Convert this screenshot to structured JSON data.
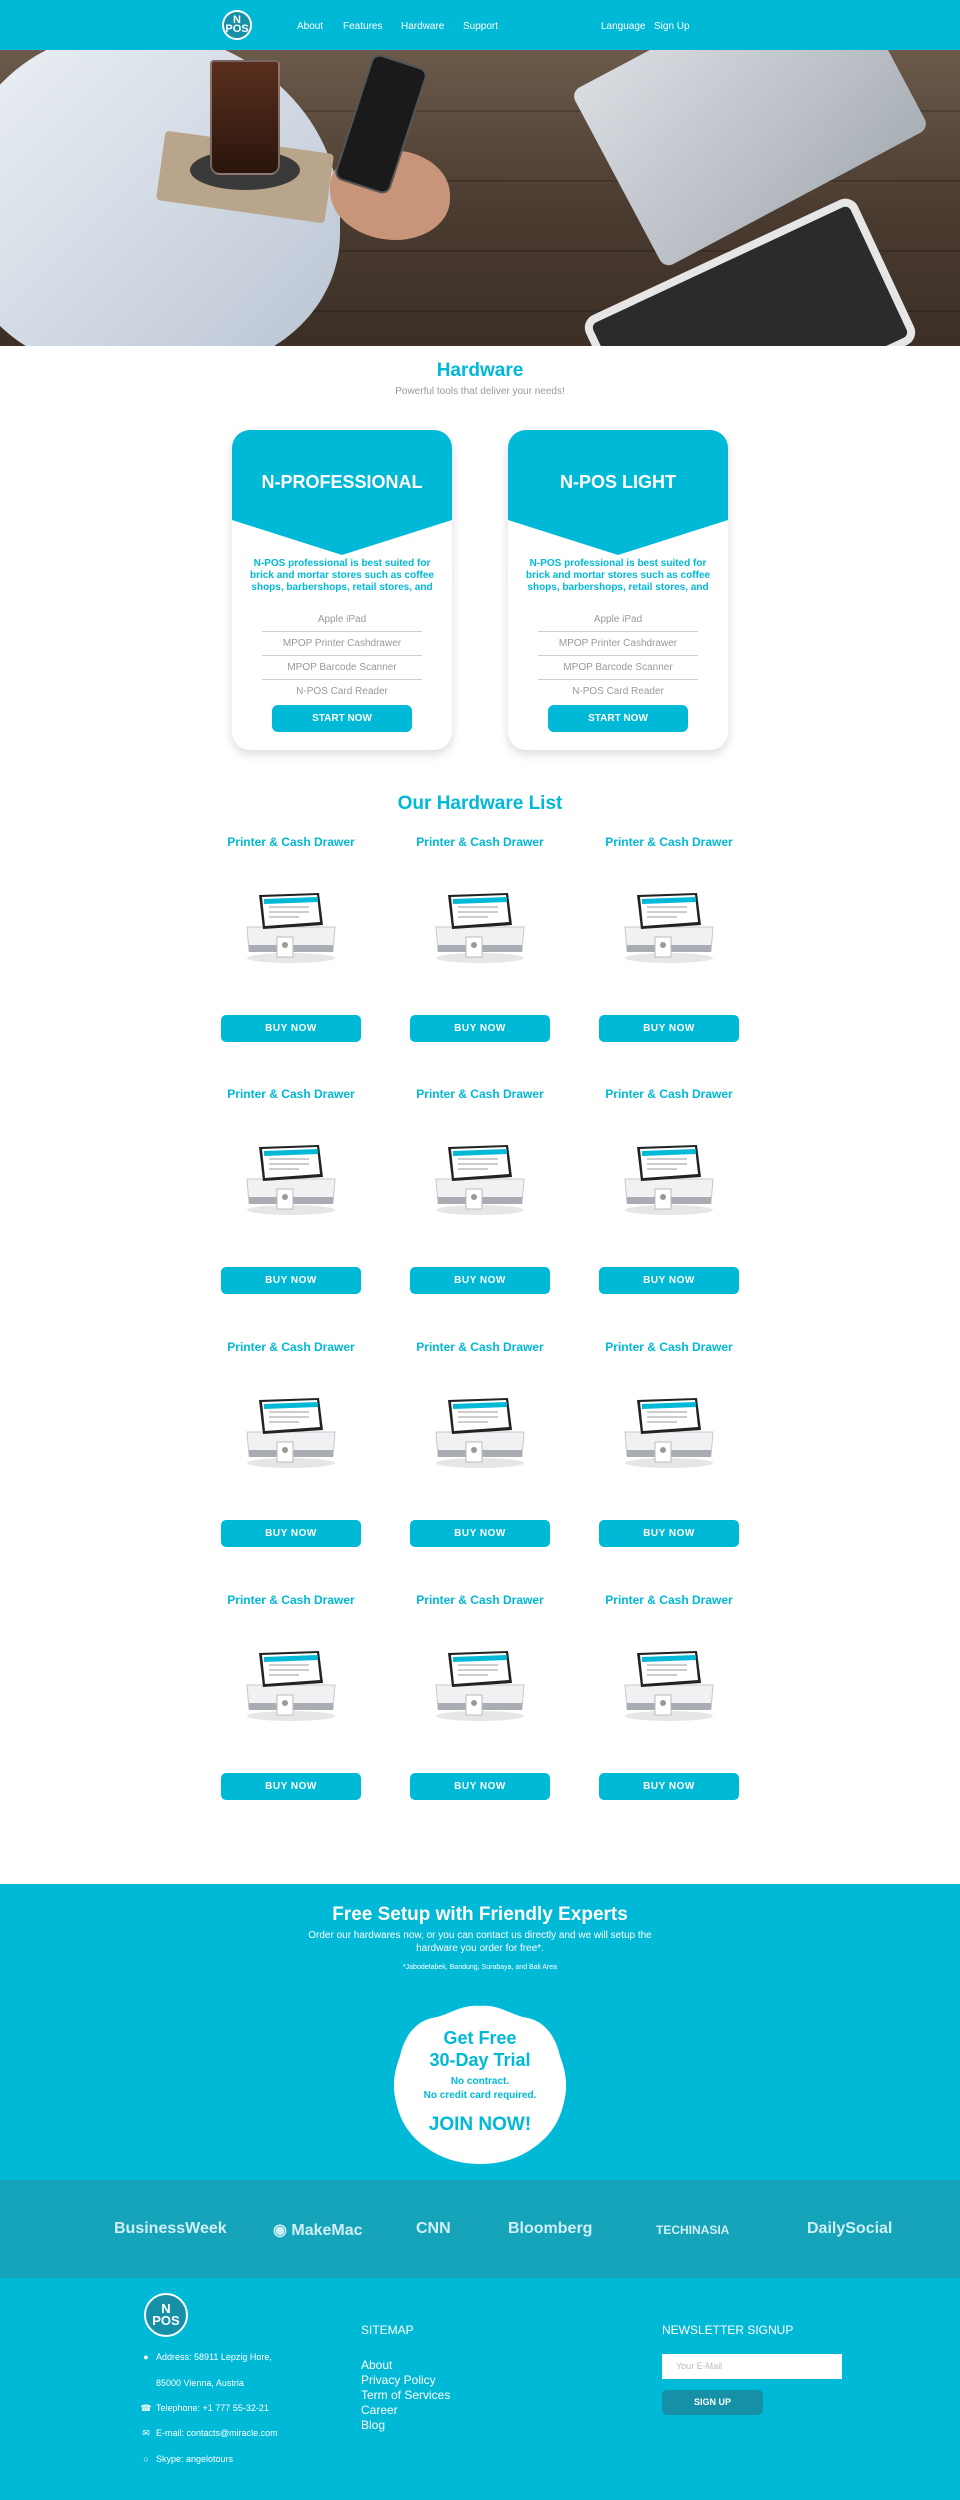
{
  "nav": {
    "logo_text": "N POS",
    "links": [
      "About",
      "Features",
      "Hardware",
      "Support"
    ],
    "language": "Language",
    "signup": "Sign Up"
  },
  "hardware": {
    "title": "Hardware",
    "subtitle": "Powerful tools that deliver your needs!"
  },
  "plans": [
    {
      "name": "N-PROFESSIONAL",
      "description": "N-POS professional is best suited for brick and mortar stores such as coffee shops, barbershops, retail stores, and",
      "features": [
        "Apple iPad",
        "MPOP Printer Cashdrawer",
        "MPOP Barcode Scanner",
        "N-POS Card Reader"
      ],
      "button": "START NOW"
    },
    {
      "name": "N-POS LIGHT",
      "description": "N-POS professional is best suited for brick and mortar stores such as coffee shops, barbershops, retail stores, and",
      "features": [
        "Apple iPad",
        "MPOP Printer Cashdrawer",
        "MPOP Barcode Scanner",
        "N-POS Card Reader"
      ],
      "button": "START NOW"
    }
  ],
  "hardware_list": {
    "title": "Our Hardware List",
    "product_title": "Printer & Cash Drawer",
    "buy_label": "BUY  NOW"
  },
  "promo": {
    "title": "Free Setup with Friendly Experts",
    "text": "Order our hardwares now, or you can contact us directly and we will setup the hardware you order for free*.",
    "note": "*Jabodetabek, Bandung, Surabaya, and Bali Area",
    "badge_line1": "Get Free",
    "badge_line2": "30-Day Trial",
    "badge_line3": "No contract.",
    "badge_line4": "No credit card required.",
    "badge_cta": "JOIN NOW!"
  },
  "press": [
    "BusinessWeek",
    "MakeMac",
    "CNN",
    "Bloomberg",
    "TECHINASIA",
    "DailySocial"
  ],
  "footer": {
    "logo_text": "N POS",
    "address_line1": "Address: 58911 Lepzig Hore,",
    "address_line2": "85000 Vienna, Austria",
    "telephone": "Telephone: +1 777 55-32-21",
    "email": "E-mail: contacts@miracle.com",
    "skype": "Skype: angelotours",
    "sitemap_title": "SITEMAP",
    "sitemap_links": [
      "About",
      "Privacy Policy",
      "Term of Services",
      "Career",
      "Blog"
    ],
    "newsletter_title": "NEWSLETTER SIGNUP",
    "email_placeholder": "Your E-Mail",
    "signup_button": "SIGN UP"
  },
  "colors": {
    "brand": "#00b9d6",
    "brand_dark": "#1590a6",
    "press_band": "#16a4ba"
  }
}
